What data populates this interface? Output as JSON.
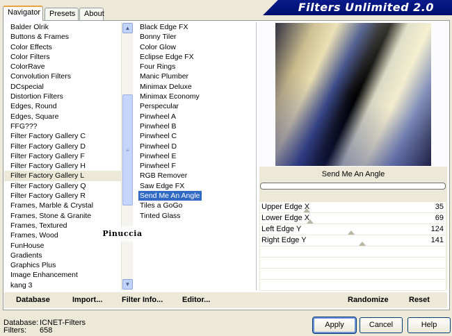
{
  "tabs": [
    "Navigator",
    "Presets",
    "About"
  ],
  "banner_title": "Filters Unlimited 2.0",
  "categories": [
    "Balder Olrik",
    "Buttons & Frames",
    "Color Effects",
    "Color Filters",
    "ColorRave",
    "Convolution Filters",
    "DCspecial",
    "Distortion Filters",
    "Edges, Round",
    "Edges, Square",
    "FFG???",
    "Filter Factory Gallery C",
    "Filter Factory Gallery D",
    "Filter Factory Gallery F",
    "Filter Factory Gallery H",
    "Filter Factory Gallery L",
    "Filter Factory Gallery Q",
    "Filter Factory Gallery R",
    "Frames, Marble & Crystal",
    "Frames, Stone & Granite",
    "Frames, Textured",
    "Frames, Wood",
    "FunHouse",
    "Gradients",
    "Graphics Plus",
    "Image Enhancement",
    "kang 3"
  ],
  "selected_category": "Filter Factory Gallery L",
  "filters": [
    "Black Edge FX",
    "Bonny Tiler",
    "Color Glow",
    "Eclipse Edge FX",
    "Four Rings",
    "Manic Plumber",
    "Minimax Deluxe",
    "Minimax Economy",
    "Perspecular",
    "Pinwheel A",
    "Pinwheel B",
    "Pinwheel C",
    "Pinwheel D",
    "Pinwheel E",
    "Pinwheel F",
    "RGB Remover",
    "Saw Edge FX",
    "Send Me An Angle",
    "Tiles a GoGo",
    "Tinted Glass"
  ],
  "selected_filter": "Send Me An Angle",
  "filter_name": "Send Me An Angle",
  "sliders": [
    {
      "label": "Upper Edge X",
      "value": "35",
      "level": 0.25
    },
    {
      "label": "Lower Edge X",
      "value": "69",
      "level": 0.27
    },
    {
      "label": "Left Edge Y",
      "value": "124",
      "level": 0.49
    },
    {
      "label": "Right Edge Y",
      "value": "141",
      "level": 0.55
    }
  ],
  "bottom_buttons": {
    "database": "Database",
    "import": "Import...",
    "filter_info": "Filter Info...",
    "editor": "Editor...",
    "randomize": "Randomize",
    "reset": "Reset"
  },
  "status": {
    "database_label": "Database:",
    "database_value": "ICNET-Filters",
    "filters_label": "Filters:",
    "filters_value": "658"
  },
  "dialog_buttons": {
    "apply": "Apply",
    "cancel": "Cancel",
    "help": "Help"
  },
  "watermark": "Pinuccia"
}
